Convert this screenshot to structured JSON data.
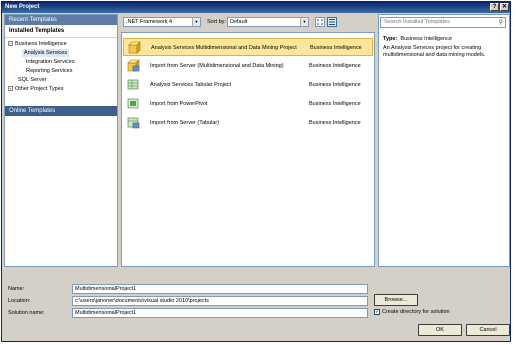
{
  "window": {
    "title": "New Project",
    "help_label": "?",
    "close_label": "✕"
  },
  "sidebar": {
    "recent_label": "Recent Templates",
    "installed_label": "Installed Templates",
    "tree": [
      {
        "label": "Business Intelligence",
        "expander": "−"
      },
      {
        "label": "Analysis Services"
      },
      {
        "label": "Integration Services"
      },
      {
        "label": "Reporting Services"
      },
      {
        "label": "SQL Server"
      },
      {
        "label": "Other Project Types",
        "expander": "+"
      }
    ],
    "online_label": "Online Templates"
  },
  "toolbar": {
    "framework_value": ".NET Framework 4",
    "sortby_label": "Sort by:",
    "sortby_value": "Default",
    "dropdown_arrow": "▼"
  },
  "templates": [
    {
      "name": "Analysis Services Multidimensional and Data Mining Project",
      "category": "Business Intelligence"
    },
    {
      "name": "Import from Server (Multidimensional and Data Mining)",
      "category": "Business Intelligence"
    },
    {
      "name": "Analysis Services Tabular Project",
      "category": "Business Intelligence"
    },
    {
      "name": "Import from PowerPivot",
      "category": "Business Intelligence"
    },
    {
      "name": "Import from Server (Tabular)",
      "category": "Business Intelligence"
    }
  ],
  "details": {
    "search_placeholder": "Search Installed Templates",
    "search_glyph": "⚲",
    "type_label": "Type:",
    "type_value": "Business Intelligence",
    "description": "An Analysis Services project for creating multidimensional and data mining models."
  },
  "form": {
    "name_label": "Name:",
    "name_value": "MultidimensionalProject1",
    "location_label": "Location:",
    "location_value": "c:\\users\\janoner\\documents\\visual studio 2010\\projects",
    "solution_label": "Solution name:",
    "solution_value": "MultidimensionalProject1",
    "browse_label": "Browse...",
    "create_dir_label": "Create directory for solution",
    "check_glyph": "✓",
    "ok_label": "OK",
    "cancel_label": "Cancel"
  }
}
